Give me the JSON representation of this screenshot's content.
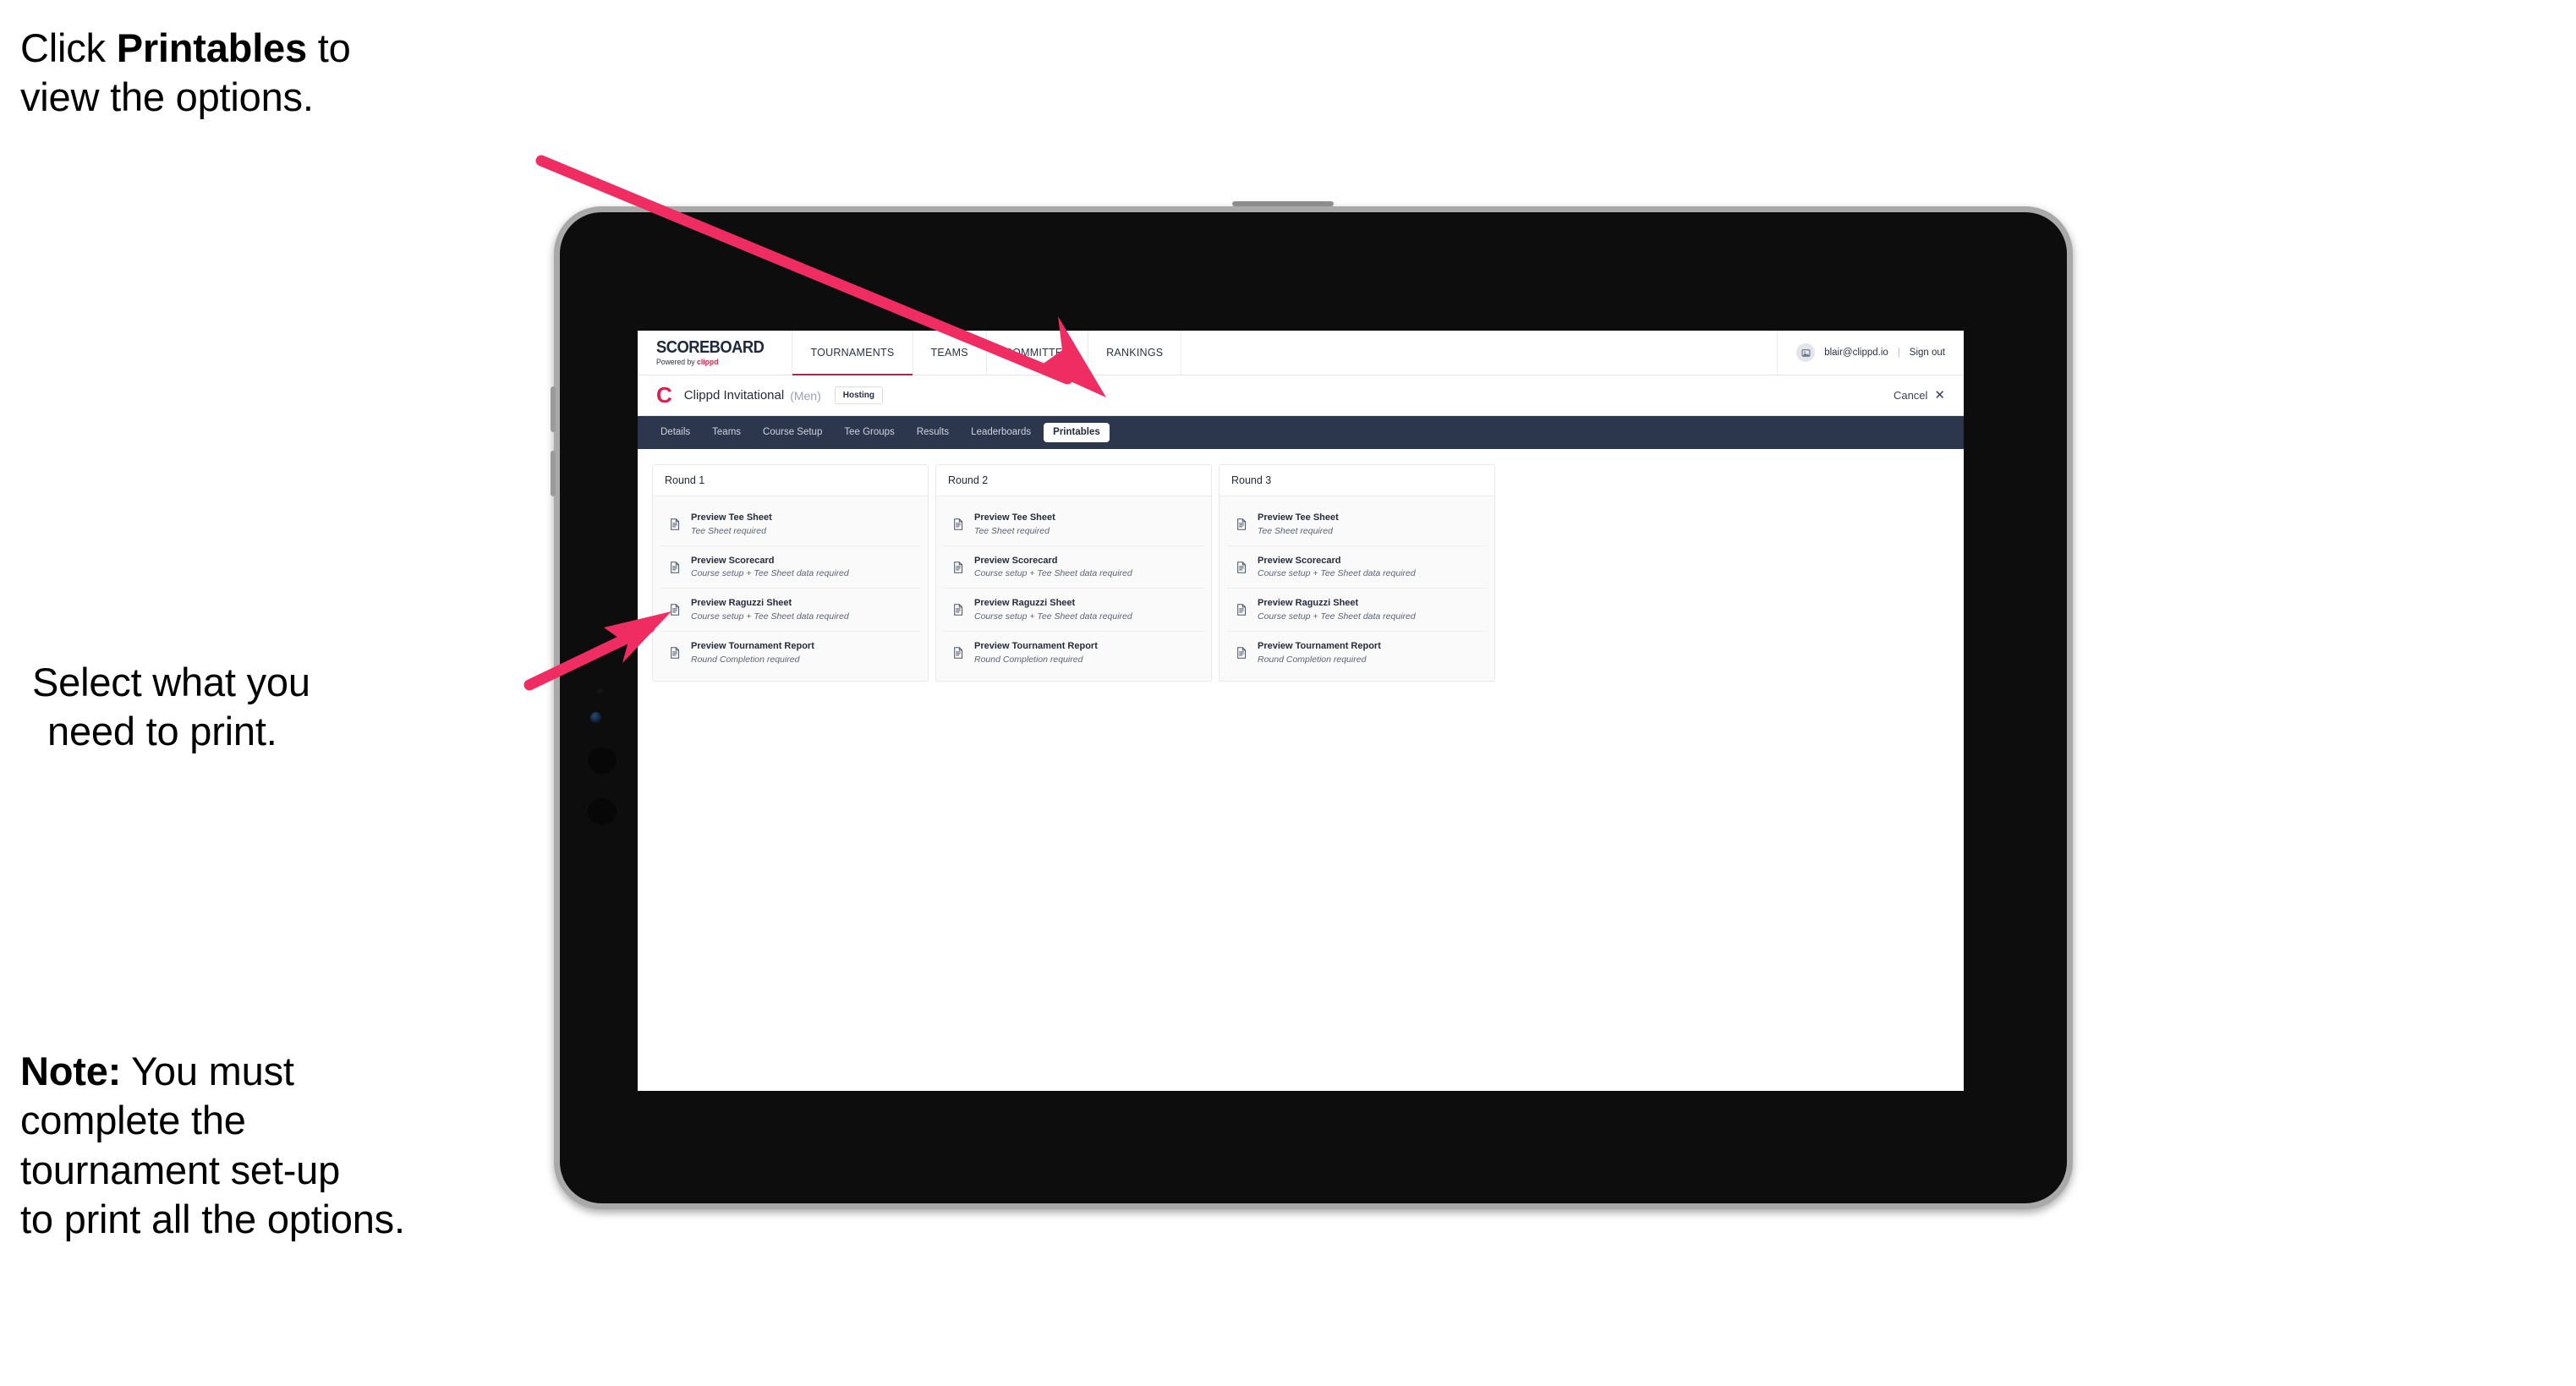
{
  "annotations": [
    {
      "id": "annot-1",
      "lines": [
        {
          "segments": [
            {
              "t": "Click ",
              "b": false
            },
            {
              "t": "Printables",
              "b": true
            },
            {
              "t": " to",
              "b": false
            }
          ]
        },
        {
          "segments": [
            {
              "t": "view the options.",
              "b": false
            }
          ]
        }
      ]
    },
    {
      "id": "annot-2",
      "lines": [
        {
          "segments": [
            {
              "t": "Select what you",
              "b": false
            }
          ]
        },
        {
          "segments": [
            {
              "t": "need to print.",
              "b": false
            }
          ]
        }
      ]
    },
    {
      "id": "annot-3",
      "lines": [
        {
          "segments": [
            {
              "t": "Note:",
              "b": true
            },
            {
              "t": " You must",
              "b": false
            }
          ]
        },
        {
          "segments": [
            {
              "t": "complete the",
              "b": false
            }
          ]
        },
        {
          "segments": [
            {
              "t": "tournament set-up",
              "b": false
            }
          ]
        },
        {
          "segments": [
            {
              "t": "to print all the options.",
              "b": false
            }
          ]
        }
      ]
    }
  ],
  "colors": {
    "accent_pink": "#ef2d63",
    "brand_red": "#e8194f",
    "tabstrip_navy": "#2c364c",
    "active_nav_underline": "#9c2f4e"
  },
  "app": {
    "logo": {
      "word": "SCOREBOARD",
      "sub_prefix": "Powered by ",
      "sub_brand": "clippd"
    },
    "nav": [
      {
        "label": "TOURNAMENTS",
        "active": true
      },
      {
        "label": "TEAMS",
        "active": false
      },
      {
        "label": "COMMITTEE",
        "active": false
      },
      {
        "label": "RANKINGS",
        "active": false
      }
    ],
    "account": {
      "avatar_icon": "user-avatar-icon",
      "email": "blair@clippd.io",
      "separator": "|",
      "sign_out": "Sign out"
    },
    "tournament": {
      "mark": "C",
      "name": "Clippd Invitational",
      "gender": "(Men)",
      "status_chip": "Hosting",
      "cancel_label": "Cancel",
      "cancel_icon": "close-icon"
    },
    "tabs": [
      {
        "label": "Details",
        "active": false
      },
      {
        "label": "Teams",
        "active": false
      },
      {
        "label": "Course Setup",
        "active": false
      },
      {
        "label": "Tee Groups",
        "active": false
      },
      {
        "label": "Results",
        "active": false
      },
      {
        "label": "Leaderboards",
        "active": false
      },
      {
        "label": "Printables",
        "active": true
      }
    ],
    "rounds": [
      {
        "title": "Round 1",
        "items": [
          {
            "title": "Preview Tee Sheet",
            "sub": "Tee Sheet required"
          },
          {
            "title": "Preview Scorecard",
            "sub": "Course setup + Tee Sheet data required"
          },
          {
            "title": "Preview Raguzzi Sheet",
            "sub": "Course setup + Tee Sheet data required"
          },
          {
            "title": "Preview Tournament Report",
            "sub": "Round Completion required"
          }
        ]
      },
      {
        "title": "Round 2",
        "items": [
          {
            "title": "Preview Tee Sheet",
            "sub": "Tee Sheet required"
          },
          {
            "title": "Preview Scorecard",
            "sub": "Course setup + Tee Sheet data required"
          },
          {
            "title": "Preview Raguzzi Sheet",
            "sub": "Course setup + Tee Sheet data required"
          },
          {
            "title": "Preview Tournament Report",
            "sub": "Round Completion required"
          }
        ]
      },
      {
        "title": "Round 3",
        "items": [
          {
            "title": "Preview Tee Sheet",
            "sub": "Tee Sheet required"
          },
          {
            "title": "Preview Scorecard",
            "sub": "Course setup + Tee Sheet data required"
          },
          {
            "title": "Preview Raguzzi Sheet",
            "sub": "Course setup + Tee Sheet data required"
          },
          {
            "title": "Preview Tournament Report",
            "sub": "Round Completion required"
          }
        ]
      }
    ]
  }
}
